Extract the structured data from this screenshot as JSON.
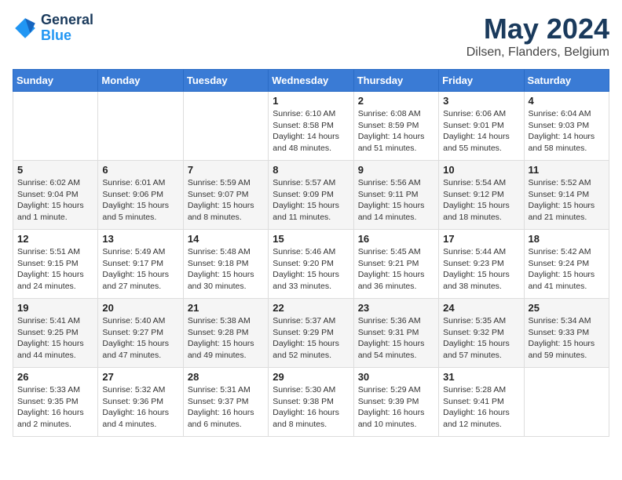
{
  "logo": {
    "line1": "General",
    "line2": "Blue"
  },
  "title": "May 2024",
  "subtitle": "Dilsen, Flanders, Belgium",
  "weekdays": [
    "Sunday",
    "Monday",
    "Tuesday",
    "Wednesday",
    "Thursday",
    "Friday",
    "Saturday"
  ],
  "weeks": [
    [
      {
        "day": "",
        "info": ""
      },
      {
        "day": "",
        "info": ""
      },
      {
        "day": "",
        "info": ""
      },
      {
        "day": "1",
        "info": "Sunrise: 6:10 AM\nSunset: 8:58 PM\nDaylight: 14 hours\nand 48 minutes."
      },
      {
        "day": "2",
        "info": "Sunrise: 6:08 AM\nSunset: 8:59 PM\nDaylight: 14 hours\nand 51 minutes."
      },
      {
        "day": "3",
        "info": "Sunrise: 6:06 AM\nSunset: 9:01 PM\nDaylight: 14 hours\nand 55 minutes."
      },
      {
        "day": "4",
        "info": "Sunrise: 6:04 AM\nSunset: 9:03 PM\nDaylight: 14 hours\nand 58 minutes."
      }
    ],
    [
      {
        "day": "5",
        "info": "Sunrise: 6:02 AM\nSunset: 9:04 PM\nDaylight: 15 hours\nand 1 minute."
      },
      {
        "day": "6",
        "info": "Sunrise: 6:01 AM\nSunset: 9:06 PM\nDaylight: 15 hours\nand 5 minutes."
      },
      {
        "day": "7",
        "info": "Sunrise: 5:59 AM\nSunset: 9:07 PM\nDaylight: 15 hours\nand 8 minutes."
      },
      {
        "day": "8",
        "info": "Sunrise: 5:57 AM\nSunset: 9:09 PM\nDaylight: 15 hours\nand 11 minutes."
      },
      {
        "day": "9",
        "info": "Sunrise: 5:56 AM\nSunset: 9:11 PM\nDaylight: 15 hours\nand 14 minutes."
      },
      {
        "day": "10",
        "info": "Sunrise: 5:54 AM\nSunset: 9:12 PM\nDaylight: 15 hours\nand 18 minutes."
      },
      {
        "day": "11",
        "info": "Sunrise: 5:52 AM\nSunset: 9:14 PM\nDaylight: 15 hours\nand 21 minutes."
      }
    ],
    [
      {
        "day": "12",
        "info": "Sunrise: 5:51 AM\nSunset: 9:15 PM\nDaylight: 15 hours\nand 24 minutes."
      },
      {
        "day": "13",
        "info": "Sunrise: 5:49 AM\nSunset: 9:17 PM\nDaylight: 15 hours\nand 27 minutes."
      },
      {
        "day": "14",
        "info": "Sunrise: 5:48 AM\nSunset: 9:18 PM\nDaylight: 15 hours\nand 30 minutes."
      },
      {
        "day": "15",
        "info": "Sunrise: 5:46 AM\nSunset: 9:20 PM\nDaylight: 15 hours\nand 33 minutes."
      },
      {
        "day": "16",
        "info": "Sunrise: 5:45 AM\nSunset: 9:21 PM\nDaylight: 15 hours\nand 36 minutes."
      },
      {
        "day": "17",
        "info": "Sunrise: 5:44 AM\nSunset: 9:23 PM\nDaylight: 15 hours\nand 38 minutes."
      },
      {
        "day": "18",
        "info": "Sunrise: 5:42 AM\nSunset: 9:24 PM\nDaylight: 15 hours\nand 41 minutes."
      }
    ],
    [
      {
        "day": "19",
        "info": "Sunrise: 5:41 AM\nSunset: 9:25 PM\nDaylight: 15 hours\nand 44 minutes."
      },
      {
        "day": "20",
        "info": "Sunrise: 5:40 AM\nSunset: 9:27 PM\nDaylight: 15 hours\nand 47 minutes."
      },
      {
        "day": "21",
        "info": "Sunrise: 5:38 AM\nSunset: 9:28 PM\nDaylight: 15 hours\nand 49 minutes."
      },
      {
        "day": "22",
        "info": "Sunrise: 5:37 AM\nSunset: 9:29 PM\nDaylight: 15 hours\nand 52 minutes."
      },
      {
        "day": "23",
        "info": "Sunrise: 5:36 AM\nSunset: 9:31 PM\nDaylight: 15 hours\nand 54 minutes."
      },
      {
        "day": "24",
        "info": "Sunrise: 5:35 AM\nSunset: 9:32 PM\nDaylight: 15 hours\nand 57 minutes."
      },
      {
        "day": "25",
        "info": "Sunrise: 5:34 AM\nSunset: 9:33 PM\nDaylight: 15 hours\nand 59 minutes."
      }
    ],
    [
      {
        "day": "26",
        "info": "Sunrise: 5:33 AM\nSunset: 9:35 PM\nDaylight: 16 hours\nand 2 minutes."
      },
      {
        "day": "27",
        "info": "Sunrise: 5:32 AM\nSunset: 9:36 PM\nDaylight: 16 hours\nand 4 minutes."
      },
      {
        "day": "28",
        "info": "Sunrise: 5:31 AM\nSunset: 9:37 PM\nDaylight: 16 hours\nand 6 minutes."
      },
      {
        "day": "29",
        "info": "Sunrise: 5:30 AM\nSunset: 9:38 PM\nDaylight: 16 hours\nand 8 minutes."
      },
      {
        "day": "30",
        "info": "Sunrise: 5:29 AM\nSunset: 9:39 PM\nDaylight: 16 hours\nand 10 minutes."
      },
      {
        "day": "31",
        "info": "Sunrise: 5:28 AM\nSunset: 9:41 PM\nDaylight: 16 hours\nand 12 minutes."
      },
      {
        "day": "",
        "info": ""
      }
    ]
  ]
}
